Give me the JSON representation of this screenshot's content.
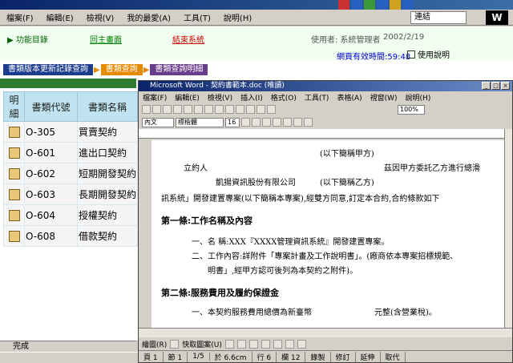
{
  "ie": {
    "menu": [
      "檔案(F)",
      "編輯(E)",
      "檢視(V)",
      "我的最愛(A)",
      "工具(T)",
      "說明(H)"
    ],
    "links_label": "連結",
    "logo": "W",
    "status_text": "完成"
  },
  "portal": {
    "nav_func": "▶ 功能目錄",
    "nav_home": "回主畫面",
    "nav_exit": "結束系統",
    "user_label": "使用者: 系統管理者",
    "user_date": "2002/2/19",
    "session_time": "網頁有效時間:59:48",
    "help": "使用說明",
    "breadcrumb": [
      "書類版本更新記錄查詢",
      "書類查詢",
      "書類查詢明細"
    ],
    "table": {
      "headers": [
        "明細",
        "書類代號",
        "書類名稱"
      ],
      "rows": [
        {
          "code": "O-305",
          "name": "買賣契約"
        },
        {
          "code": "O-601",
          "name": "進出口契約"
        },
        {
          "code": "O-602",
          "name": "短期開發契約"
        },
        {
          "code": "O-603",
          "name": "長期開發契約"
        },
        {
          "code": "O-604",
          "name": "授權契約"
        },
        {
          "code": "O-608",
          "name": "借款契約"
        }
      ]
    }
  },
  "word": {
    "title": "Microsoft Word - 契約書範本.doc (唯讀)",
    "menu": [
      "檔案(F)",
      "編輯(E)",
      "檢視(V)",
      "插入(I)",
      "格式(O)",
      "工具(T)",
      "表格(A)",
      "視窗(W)",
      "說明(H)"
    ],
    "style_box": "內文",
    "font_box": "標楷體",
    "size_box": "16",
    "zoom_box": "100%",
    "doc": {
      "line1": "(以下簡稱甲方)",
      "line2a": "立約人",
      "line2b": "茲因甲方委託乙方進行總滑",
      "line3a": "凱揚資訊股份有限公司",
      "line3b": "(以下簡稱乙方)",
      "line4": "訊系統」開發建置專案(以下簡稱本專案),經雙方同意,訂定本合約,合約條款如下",
      "h1": "第一條:工作名稱及內容",
      "l5": "一、名    稱:XXX『XXXX管理資訊系統』開發建置專案。",
      "l6": "二、工作內容:詳附件「專案計畫及工作說明書」。(廠商依本專案招標規範、",
      "l7": "明書」,經甲方認可後列為本契約之附件)。",
      "h2": "第二條:服務費用及履約保證金",
      "l8": "一、本契約服務費用總價為新臺幣",
      "l8b": "元整(含營業稅)。"
    },
    "draw_label": "繪圖(R)",
    "autoshape_label": "快取圖案(U)",
    "status": [
      "頁 1",
      "節 1",
      "1/5",
      "於 6.6cm",
      "行 6",
      "欄 12",
      "錄製",
      "修訂",
      "延伸",
      "取代"
    ]
  },
  "taskbar": {}
}
